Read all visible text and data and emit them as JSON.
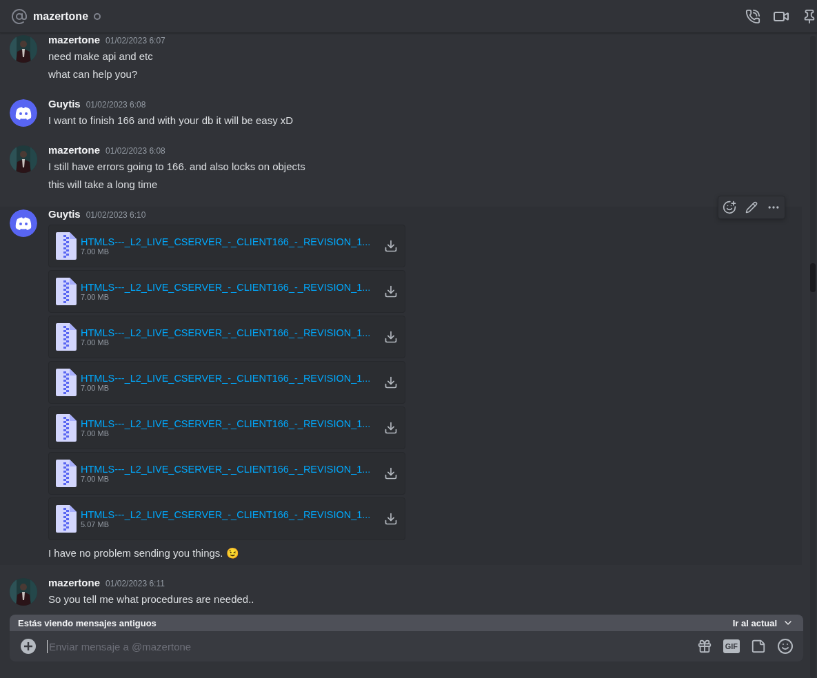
{
  "channel": {
    "name": "mazertone",
    "online": false
  },
  "messages": [
    {
      "author": "mazertone",
      "time": "01/02/2023 6:07",
      "hovered": false,
      "lines": [
        "need make api and etc",
        "what can help you?"
      ]
    },
    {
      "author": "Guytis",
      "time": "01/02/2023 6:08",
      "kind": "default",
      "hovered": false,
      "lines": [
        "I want to finish 166 and with your db it will be easy xD"
      ]
    },
    {
      "author": "mazertone",
      "time": "01/02/2023 6:08",
      "hovered": false,
      "lines": [
        "I still have errors going to 166. and also locks on objects",
        "this will take a long time"
      ]
    },
    {
      "author": "Guytis",
      "time": "01/02/2023 6:10",
      "kind": "default",
      "hovered": true,
      "attachments": [
        {
          "name": "HTMLS---_L2_LIVE_CSERVER_-_CLIENT166_-_REVISION_1...",
          "size": "7.00 MB"
        },
        {
          "name": "HTMLS---_L2_LIVE_CSERVER_-_CLIENT166_-_REVISION_1...",
          "size": "7.00 MB"
        },
        {
          "name": "HTMLS---_L2_LIVE_CSERVER_-_CLIENT166_-_REVISION_1...",
          "size": "7.00 MB"
        },
        {
          "name": "HTMLS---_L2_LIVE_CSERVER_-_CLIENT166_-_REVISION_1...",
          "size": "7.00 MB"
        },
        {
          "name": "HTMLS---_L2_LIVE_CSERVER_-_CLIENT166_-_REVISION_1...",
          "size": "7.00 MB"
        },
        {
          "name": "HTMLS---_L2_LIVE_CSERVER_-_CLIENT166_-_REVISION_1...",
          "size": "7.00 MB"
        },
        {
          "name": "HTMLS---_L2_LIVE_CSERVER_-_CLIENT166_-_REVISION_1...",
          "size": "5.07 MB"
        }
      ],
      "lines": [
        "I have no problem sending you things. 😉"
      ]
    },
    {
      "author": "mazertone",
      "time": "01/02/2023 6:11",
      "hovered": false,
      "lines": [
        "So you tell me what procedures are needed.."
      ]
    }
  ],
  "jump_banner": {
    "text": "Estás viendo mensajes antiguos",
    "action": "Ir al actual"
  },
  "composer": {
    "placeholder": "Enviar mensaje a @mazertone",
    "gif_label": "GIF"
  }
}
